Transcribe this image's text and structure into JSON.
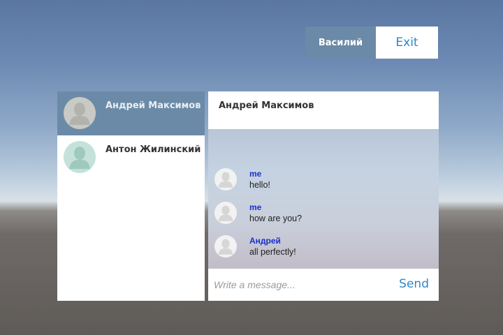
{
  "userbar": {
    "username": "Василий",
    "exit_label": "Exit"
  },
  "contacts": [
    {
      "name": "Андрей Максимов",
      "active": true
    },
    {
      "name": "Антон Жилинский",
      "active": false
    }
  ],
  "chat": {
    "title": "Андрей Максимов",
    "messages": [
      {
        "author": "me",
        "text": "hello!"
      },
      {
        "author": "me",
        "text": "how are you?"
      },
      {
        "author": "Андрей",
        "text": "all perfectly!"
      }
    ],
    "input_placeholder": "Write a message...",
    "send_label": "Send"
  },
  "colors": {
    "accent_blue": "#2f86c8",
    "selected_bg": "#6b8aa8",
    "author_blue": "#1a2fd0"
  }
}
